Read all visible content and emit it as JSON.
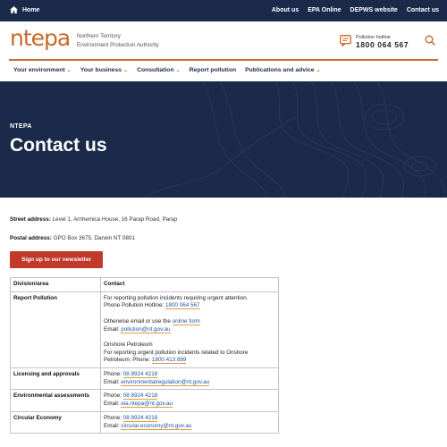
{
  "topbar": {
    "home_label": "Home",
    "links": [
      "About us",
      "EPA Online",
      "DEPWS website",
      "Contact us"
    ]
  },
  "header": {
    "logo_text": "ntepa",
    "logo_sub_line1": "Northern Territory",
    "logo_sub_line2": "Environment Protection Authority",
    "hotline_label": "Pollution hotline",
    "hotline_number": "1800 064 567"
  },
  "nav": {
    "items": [
      {
        "label": "Your environment",
        "has_dropdown": true
      },
      {
        "label": "Your business",
        "has_dropdown": true
      },
      {
        "label": "Consultation",
        "has_dropdown": true
      },
      {
        "label": "Report pollution",
        "has_dropdown": false
      },
      {
        "label": "Publications and advice",
        "has_dropdown": true
      }
    ]
  },
  "hero": {
    "kicker": "NTEPA",
    "title": "Contact us"
  },
  "content": {
    "street_label": "Street address:",
    "street_value": " Level 1, Arnhemica House, 16 Parap Road, Parap",
    "postal_label": "Postal address:",
    "postal_value": " GPO Box 3675, Darwin NT 0801",
    "newsletter_button": "Sign up to our newsletter"
  },
  "table": {
    "headers": [
      "Division/area",
      "Contact"
    ],
    "rows": {
      "report": {
        "area": "Report Pollution",
        "line1": "For reporting pollution incidents requiring urgent attention.",
        "phone_prefix": "Phone Pollution Hotline: ",
        "phone": "1800 064 567",
        "other_prefix": "Otherwise email or use the ",
        "online_form": "online form",
        "email_prefix": "Email: ",
        "email": "pollution@nt.gov.au",
        "onshore_title": "Onshore Petroleum",
        "onshore_line": "For reporting urgent pollution incidents related to Onshore",
        "onshore_phone_prefix": "Petroleum: Phone: ",
        "onshore_phone": "1800 413 889"
      },
      "licensing": {
        "area": "Licensing and approvals",
        "phone_prefix": "Phone: ",
        "phone": "08 8924 4218",
        "email_prefix": "Email: ",
        "email": "environmentalregulation@nt.gov.au"
      },
      "assessments": {
        "area": "Environmental assessments",
        "phone_prefix": "Phone: ",
        "phone": "08 8924 4218",
        "email_prefix": "Email: ",
        "email": "eia.ntepa@nt.gov.au"
      },
      "circular": {
        "area": "Circular Economy",
        "phone_prefix": "Phone: ",
        "phone": "08 8924 4218",
        "email_prefix": "Email: ",
        "email": "circular.economy@nt.gov.au"
      }
    }
  },
  "colors": {
    "navy": "#1b2a4a",
    "orange": "#c86a2c",
    "button_red": "#c0392b",
    "link_blue": "#1a56a8"
  }
}
